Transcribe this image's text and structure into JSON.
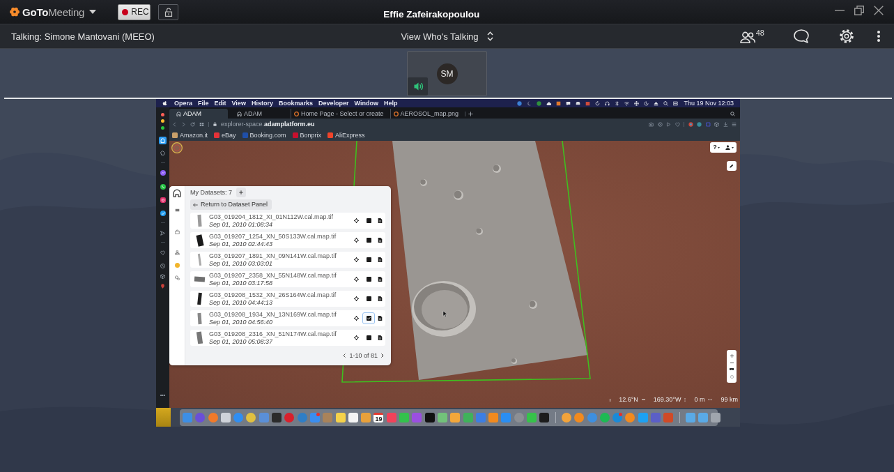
{
  "app": {
    "logo": "**GoTo**Meeting"
  },
  "recording": {
    "label": "REC",
    "on": true
  },
  "window": {
    "title": "Effie Zafeirakopoulou"
  },
  "toolbar": {
    "talking": "Talking: Simone Mantovani (MEEO)",
    "view_mode": "View Who's Talking",
    "participant_count": "48"
  },
  "presenter_thumbnail": {
    "initials": "SM",
    "speaking": true
  },
  "shared_screen": {
    "menu_bar": {
      "items": [
        "Opera",
        "File",
        "Edit",
        "View",
        "History",
        "Bookmarks",
        "Developer",
        "Window",
        "Help"
      ],
      "clock": "Thu 19 Nov 12:03"
    },
    "tabs": [
      {
        "title": "ADAM",
        "kind": "app",
        "selected": true
      },
      {
        "title": "ADAM",
        "kind": "app",
        "selected": false
      },
      {
        "title": "Home Page - Select or create",
        "kind": "web",
        "selected": false
      },
      {
        "title": "AEROSOL_map.png",
        "kind": "web",
        "selected": false
      }
    ],
    "address": "explorer-space.**adamplatform.eu**",
    "bookmarks": [
      "Amazon.it",
      "eBay",
      "Booking.com",
      "Bonprix",
      "AliExpress"
    ],
    "map": {
      "help": "?",
      "readouts": [
        "12.6°N",
        "169.30°W",
        "0 m",
        "99 km"
      ]
    },
    "datasets": {
      "title": "My Datasets: 7",
      "back": "Return to Dataset Panel",
      "rows": [
        {
          "filename": "G03_019204_1812_XI_01N112W.cal.map.tif",
          "timestamp": "Sep 01, 2010 01:08:34",
          "selected": false
        },
        {
          "filename": "G03_019207_1254_XN_50S133W.cal.map.tif",
          "timestamp": "Sep 01, 2010 02:44:43",
          "selected": false
        },
        {
          "filename": "G03_019207_1891_XN_09N141W.cal.map.tif",
          "timestamp": "Sep 01, 2010 03:03:01",
          "selected": false
        },
        {
          "filename": "G03_019207_2358_XN_55N148W.cal.map.tif",
          "timestamp": "Sep 01, 2010 03:17:58",
          "selected": false
        },
        {
          "filename": "G03_019208_1532_XN_26S164W.cal.map.tif",
          "timestamp": "Sep 01, 2010 04:44:13",
          "selected": false
        },
        {
          "filename": "G03_019208_1934_XN_13N169W.cal.map.tif",
          "timestamp": "Sep 01, 2010 04:56:40",
          "selected": true
        },
        {
          "filename": "G03_019208_2316_XN_51N174W.cal.map.tif",
          "timestamp": "Sep 01, 2010 05:08:37",
          "selected": false
        }
      ],
      "pagination": "1-10 of 81"
    },
    "dock": {
      "calendar_day": "19"
    }
  }
}
